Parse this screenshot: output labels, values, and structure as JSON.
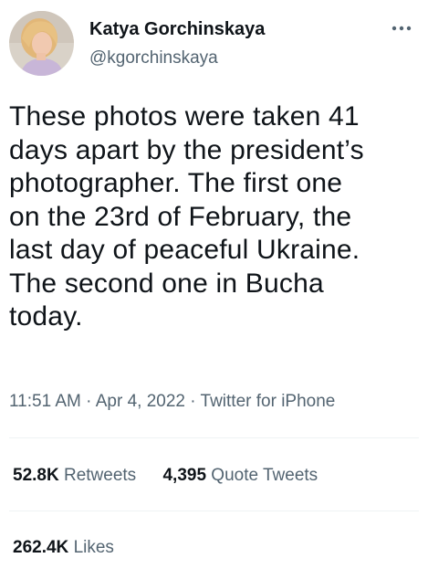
{
  "user": {
    "display_name": "Katya Gorchinskaya",
    "handle": "@kgorchinskaya",
    "avatar_icon": "profile-photo"
  },
  "more_icon": "ellipsis-icon",
  "tweet": {
    "lines": [
      "These photos were taken 41",
      "days apart by the president’s",
      "photographer. The first one",
      "on the 23rd of February, the",
      "last day of peaceful Ukraine.",
      "The second one in Bucha",
      "today."
    ],
    "time": "11:51 AM",
    "separator": "·",
    "date": "Apr 4, 2022",
    "source": "Twitter for iPhone"
  },
  "stats": {
    "retweets_count": "52.8K",
    "retweets_label": "Retweets",
    "quotes_count": "4,395",
    "quotes_label": "Quote Tweets",
    "likes_count": "262.4K",
    "likes_label": "Likes"
  },
  "colors": {
    "text_primary": "#0f1419",
    "text_secondary": "#536471",
    "divider": "#eff3f4"
  }
}
